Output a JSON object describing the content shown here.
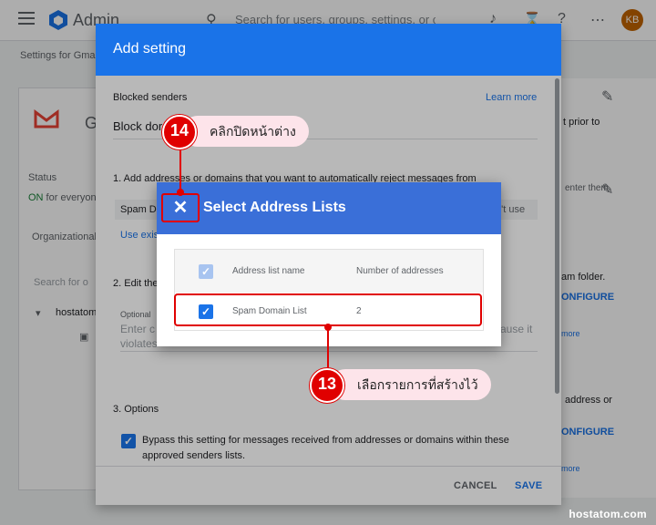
{
  "app": {
    "brand": "Admin",
    "search_placeholder": "Search for users, groups, settings, or c",
    "avatar_initials": "KB",
    "breadcrumb": "Settings for Gma"
  },
  "left_panel": {
    "app_initial": "G",
    "status_label": "Status",
    "status_on": "ON",
    "status_rest": " for everyon",
    "org_label": "Organizational",
    "search_placeholder": "Search for o",
    "tree_item": "hostatom"
  },
  "right_panel": {
    "text1": "t prior to",
    "text2": "enter them",
    "text3": "am folder.",
    "configure1": "ONFIGURE",
    "more1": "more",
    "text4": "address or",
    "configure2": "ONFIGURE",
    "more2": "more"
  },
  "add_setting_dialog": {
    "title": "Add setting",
    "section_label": "Blocked senders",
    "learn_more": "Learn more",
    "name_value": "Block dor",
    "step1": "1. Add addresses or domains that you want to automatically reject messages from",
    "list_item": "Spam D",
    "dont_use": "n't use",
    "use_existing": "Use exis",
    "step2": "2. Edit the",
    "optional_label": "Optional",
    "optional_placeholder": "Enter c",
    "optional_tail": "ause it",
    "optional_line2": "violates",
    "step3": "3. Options",
    "bypass_text_line1": "Bypass this setting for messages received from addresses or domains within these",
    "bypass_text_line2": "approved senders lists.",
    "cancel": "CANCEL",
    "save": "SAVE"
  },
  "select_address_lists": {
    "title": "Select Address Lists",
    "close_icon": "close-icon",
    "columns": [
      "Address list name",
      "Number of addresses"
    ],
    "rows": [
      {
        "name": "Spam Domain List",
        "count": "2",
        "checked": true
      }
    ]
  },
  "annotations": {
    "step14_number": "14",
    "step14_text": "คลิกปิดหน้าต่าง",
    "step13_number": "13",
    "step13_text": "เลือกรายการที่สร้างไว้"
  },
  "watermark": "hostatom.com",
  "colors": {
    "primary_blue": "#1a73e8",
    "header_blue": "#3a6fd8",
    "annotation_red": "#e00000",
    "status_green": "#188038"
  }
}
